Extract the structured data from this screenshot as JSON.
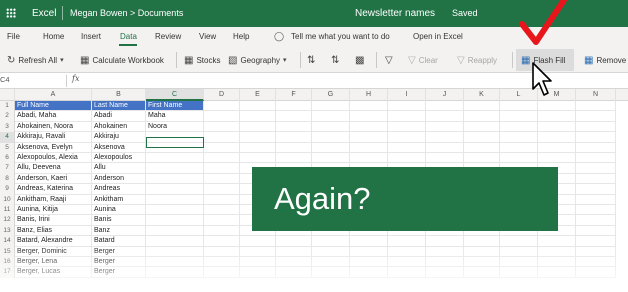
{
  "titlebar": {
    "app": "Excel",
    "breadcrumb": "Megan Bowen > Documents",
    "doc_title": "Newsletter names",
    "status": "Saved"
  },
  "menu": {
    "items": [
      "File",
      "Home",
      "Insert",
      "Data",
      "Review",
      "View",
      "Help"
    ],
    "active": "Data",
    "tell_me": "Tell me what you want to do",
    "open_in": "Open in Excel"
  },
  "ribbon": {
    "refresh_all": "Refresh All",
    "calculate": "Calculate Workbook",
    "stocks": "Stocks",
    "geography": "Geography",
    "clear": "Clear",
    "reapply": "Reapply",
    "flash_fill": "Flash Fill",
    "remove": "Remove"
  },
  "formula_bar": {
    "name_box": "C4",
    "fx": "fx",
    "value": ""
  },
  "grid": {
    "columns": [
      "A",
      "B",
      "C",
      "D",
      "E",
      "F",
      "G",
      "H",
      "I",
      "J",
      "K",
      "L",
      "M",
      "N"
    ],
    "selected_column": "C",
    "selected_row": "4",
    "rows": [
      {
        "n": "1",
        "a": "Full Name",
        "b": "Last Name",
        "c": "First Name"
      },
      {
        "n": "2",
        "a": "Abadi, Maha",
        "b": "Abadi",
        "c": "Maha"
      },
      {
        "n": "3",
        "a": "Ahokainen, Noora",
        "b": "Ahokainen",
        "c": "Noora"
      },
      {
        "n": "4",
        "a": "Akkiraju, Ravali",
        "b": "Akkiraju",
        "c": ""
      },
      {
        "n": "5",
        "a": "Aksenova, Evelyn",
        "b": "Aksenova",
        "c": ""
      },
      {
        "n": "6",
        "a": "Alexopoulos, Alexia",
        "b": "Alexopoulos",
        "c": ""
      },
      {
        "n": "7",
        "a": "Allu, Deevena",
        "b": "Allu",
        "c": ""
      },
      {
        "n": "8",
        "a": "Anderson, Kaeri",
        "b": "Anderson",
        "c": ""
      },
      {
        "n": "9",
        "a": "Andreas, Katerina",
        "b": "Andreas",
        "c": ""
      },
      {
        "n": "10",
        "a": "Ankitham, Raaji",
        "b": "Ankitham",
        "c": ""
      },
      {
        "n": "11",
        "a": "Aunina, Kitija",
        "b": "Aunina",
        "c": ""
      },
      {
        "n": "12",
        "a": "Banis, Irini",
        "b": "Banis",
        "c": ""
      },
      {
        "n": "13",
        "a": "Banz, Elias",
        "b": "Banz",
        "c": ""
      },
      {
        "n": "14",
        "a": "Batard, Alexandre",
        "b": "Batard",
        "c": ""
      },
      {
        "n": "15",
        "a": "Berger, Dominic",
        "b": "Berger",
        "c": ""
      },
      {
        "n": "16",
        "a": "Berger, Lena",
        "b": "Berger",
        "c": ""
      },
      {
        "n": "17",
        "a": "Berger, Lucas",
        "b": "Berger",
        "c": ""
      }
    ]
  },
  "overlay": {
    "text": "Again?"
  },
  "colors": {
    "excel_green": "#217346",
    "header_blue": "#4472c4",
    "annotation_red": "#e8151b"
  }
}
